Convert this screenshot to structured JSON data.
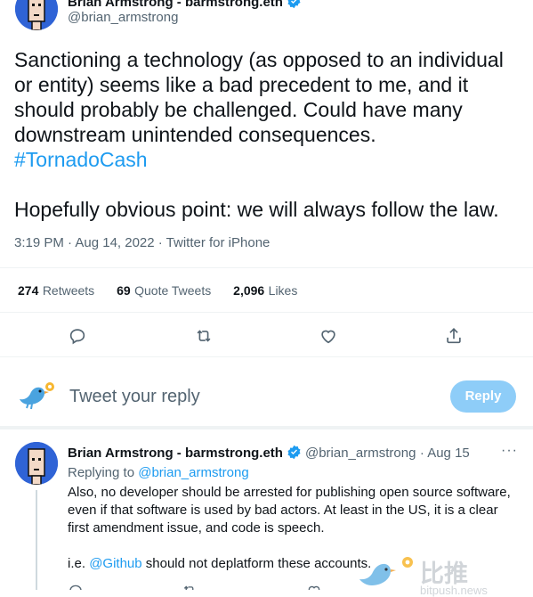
{
  "tweet": {
    "author_name": "Brian Armstrong - barmstrong.eth",
    "author_handle": "@brian_armstrong",
    "text_line1": "Sanctioning a technology (as opposed to an individual",
    "text_line2": "or entity) seems like a bad precedent to me, and it",
    "text_line3": "should probably be challenged. Could have many",
    "text_line4": "downstream unintended consequences.",
    "hashtag": "#TornadoCash",
    "text_line5": "Hopefully obvious point: we will always follow the law.",
    "timestamp": "3:19 PM · Aug 14, 2022 · Twitter for iPhone"
  },
  "stats": {
    "retweets_count": "274",
    "retweets_label": "Retweets",
    "quotes_count": "69",
    "quotes_label": "Quote Tweets",
    "likes_count": "2,096",
    "likes_label": "Likes"
  },
  "actions": {
    "reply_icon": "reply-icon",
    "retweet_icon": "retweet-icon",
    "like_icon": "like-icon",
    "share_icon": "share-icon"
  },
  "composer": {
    "placeholder": "Tweet your reply",
    "button_label": "Reply"
  },
  "reply": {
    "author_name": "Brian Armstrong - barmstrong.eth",
    "author_handle": "@brian_armstrong",
    "date": "· Aug 15",
    "replying_to_prefix": "Replying to",
    "replying_to_handle": "@brian_armstrong",
    "line1": "Also, no developer should be arrested for publishing open source software,",
    "line2": "even if that software is used by bad actors. At least in the US, it is a clear",
    "line3": "first amendment issue, and code is speech.",
    "line4_prefix": "i.e.",
    "line4_mention": "@Github",
    "line4_suffix": "should not deplatform these accounts.",
    "more": "···"
  },
  "watermark": {
    "text": "比推",
    "subtext": "bitpush.news"
  },
  "colors": {
    "accent": "#1d9bf0",
    "text": "#0f1419",
    "secondary": "#536471",
    "avatar_bg": "#2f63d6",
    "reply_button": "#8ecdf8"
  }
}
